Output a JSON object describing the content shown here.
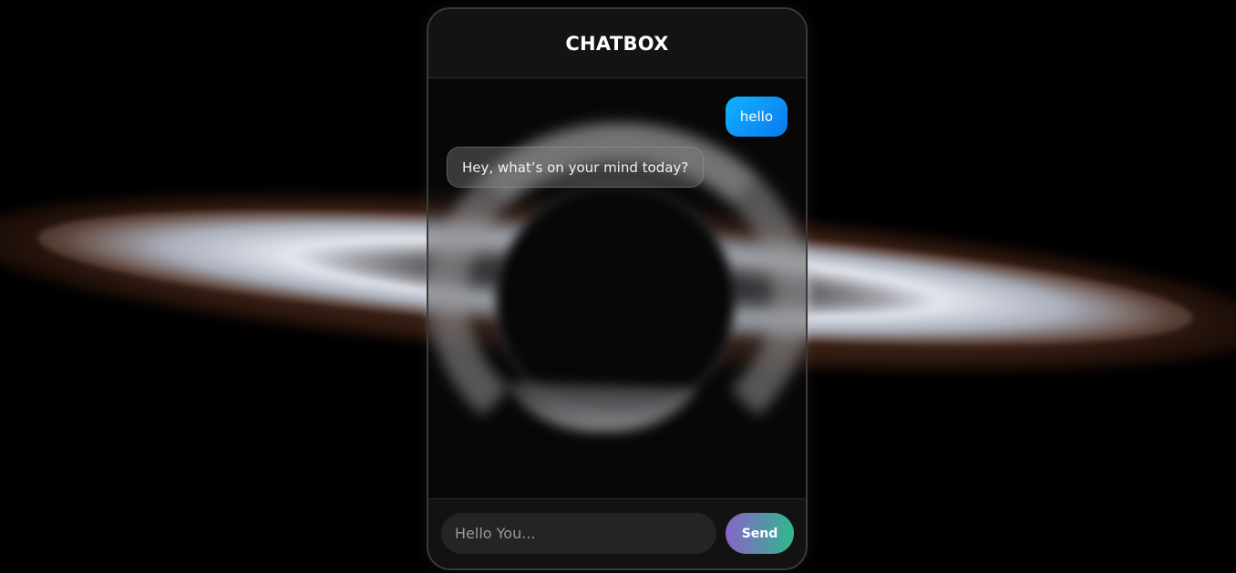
{
  "header": {
    "title": "CHATBOX"
  },
  "messages": [
    {
      "role": "user",
      "text": "hello"
    },
    {
      "role": "bot",
      "text": "Hey, what’s on your mind today?"
    }
  ],
  "composer": {
    "placeholder": "Hello You...",
    "send_label": "Send"
  },
  "colors": {
    "user_bubble": "#0a9cff",
    "send_gradient_start": "#8a63c9",
    "send_gradient_end": "#2fb88e"
  }
}
